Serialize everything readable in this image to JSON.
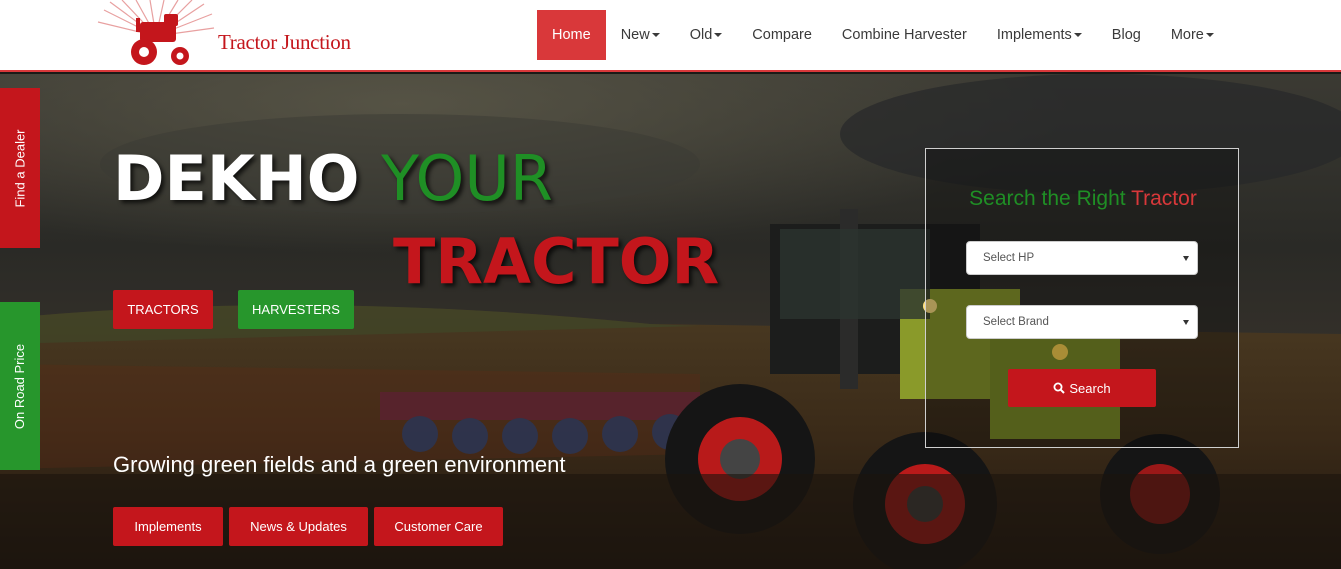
{
  "brand": {
    "name": "Tractor Junction"
  },
  "nav": {
    "items": [
      {
        "label": "Home",
        "active": true,
        "dropdown": false
      },
      {
        "label": "New",
        "active": false,
        "dropdown": true
      },
      {
        "label": "Old",
        "active": false,
        "dropdown": true
      },
      {
        "label": "Compare",
        "active": false,
        "dropdown": false
      },
      {
        "label": "Combine Harvester",
        "active": false,
        "dropdown": false
      },
      {
        "label": "Implements",
        "active": false,
        "dropdown": true
      },
      {
        "label": "Blog",
        "active": false,
        "dropdown": false
      },
      {
        "label": "More",
        "active": false,
        "dropdown": true
      }
    ]
  },
  "side_tabs": {
    "dealer": "Find a Dealer",
    "price": "On Road Price"
  },
  "hero": {
    "headline_word1": "DEKHO",
    "headline_word2": "YOUR",
    "headline_word3": "TRACTOR",
    "btn_tractors": "TRACTORS",
    "btn_harvesters": "HARVESTERS",
    "tagline": "Growing green fields and a green environment",
    "btn_implements": "Implements",
    "btn_news": "News & Updates",
    "btn_care": "Customer Care"
  },
  "search": {
    "title_part1": "Search the Right",
    "title_part2": "Tractor",
    "hp_value": "Select HP",
    "brand_value": "Select Brand",
    "button_label": "Search"
  },
  "colors": {
    "brand_red": "#c4161c",
    "nav_active": "#d9383a",
    "brand_green": "#27962c"
  }
}
